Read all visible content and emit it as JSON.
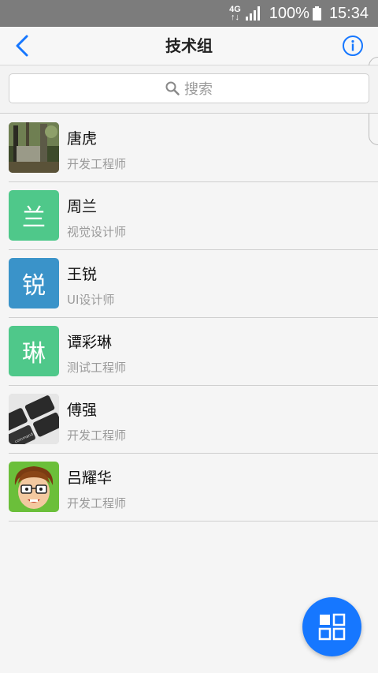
{
  "status_bar": {
    "network_top": "4G",
    "network_bottom": "↑↓",
    "battery": "100%",
    "time": "15:34"
  },
  "nav": {
    "title": "技术组"
  },
  "search": {
    "placeholder": "搜索"
  },
  "members": [
    {
      "name": "唐虎",
      "role": "开发工程师",
      "avatar_type": "photo-forest"
    },
    {
      "name": "周兰",
      "role": "视觉设计师",
      "avatar_type": "letter",
      "avatar_char": "兰",
      "avatar_color": "#4fc88a"
    },
    {
      "name": "王锐",
      "role": "UI设计师",
      "avatar_type": "letter",
      "avatar_char": "锐",
      "avatar_color": "#3a93c9"
    },
    {
      "name": "谭彩琳",
      "role": "测试工程师",
      "avatar_type": "letter",
      "avatar_char": "琳",
      "avatar_color": "#4fc88a"
    },
    {
      "name": "傅强",
      "role": "开发工程师",
      "avatar_type": "photo-keyboard"
    },
    {
      "name": "吕耀华",
      "role": "开发工程师",
      "avatar_type": "cartoon-face"
    }
  ],
  "colors": {
    "accent": "#1677ff"
  }
}
